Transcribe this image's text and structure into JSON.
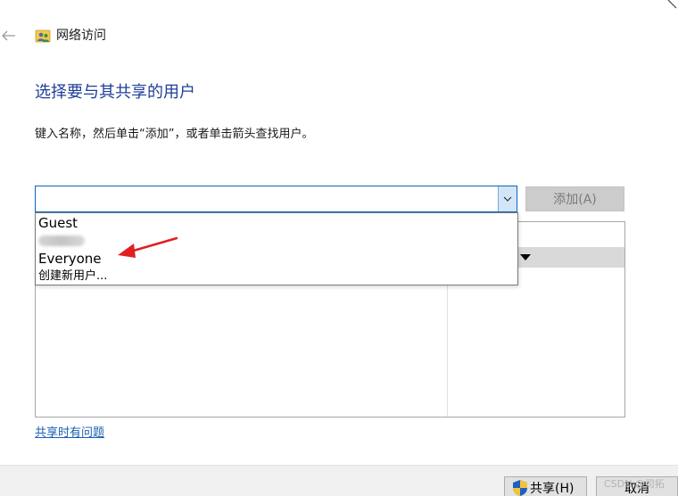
{
  "window": {
    "title": "网络访问",
    "back_icon": "back-arrow-icon",
    "app_icon": "network-users-icon"
  },
  "main": {
    "heading": "选择要与其共享的用户",
    "instruction": "键入名称，然后单击“添加”，或者单击箭头查找用户。",
    "combo": {
      "value": "",
      "arrow_icon": "chevron-down-icon"
    },
    "add_button": "添加(A)",
    "dropdown": {
      "items": [
        "Guest",
        "",
        "Everyone",
        "创建新用户..."
      ],
      "blurred_item_index": 1
    },
    "annotation_color": "#e02020",
    "help_link": "共享时有问题"
  },
  "footer": {
    "share_button": "共享(H)",
    "share_icon": "uac-shield-icon",
    "cancel_button": "取消",
    "watermark": "CSDN @司拓"
  }
}
